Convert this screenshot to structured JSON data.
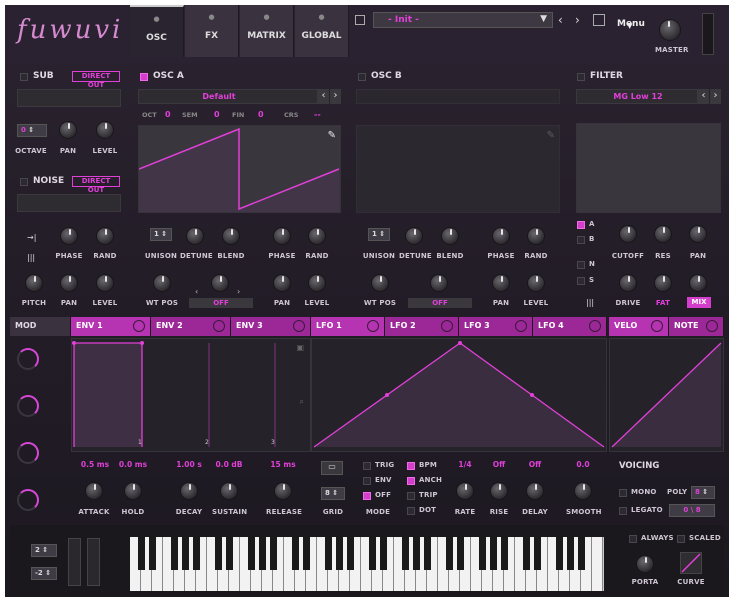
{
  "header": {
    "logo": "fuwuvi",
    "tabs": [
      "OSC",
      "FX",
      "MATRIX",
      "GLOBAL"
    ],
    "active_tab": "OSC",
    "preset_name": "- Init -",
    "menu_label": "Menu",
    "master_label": "MASTER"
  },
  "sub": {
    "title": "SUB",
    "direct_out": "DIRECT OUT",
    "octave_value": "0",
    "labels": [
      "OCTAVE",
      "PAN",
      "LEVEL"
    ]
  },
  "noise": {
    "title": "NOISE",
    "direct_out": "DIRECT OUT"
  },
  "osc_a": {
    "title": "OSC A",
    "wavetable": "Default",
    "oct_label": "OCT",
    "oct_value": "0",
    "sem_label": "SEM",
    "sem_value": "0",
    "fin_label": "FIN",
    "fin_value": "0",
    "crs_label": "CRS",
    "crs_value": "--",
    "unison_value": "1",
    "row1_labels": [
      "PHASE",
      "RAND"
    ],
    "row2_labels": [
      "UNISON",
      "DETUNE",
      "BLEND",
      "PHASE",
      "RAND"
    ],
    "row3_labels": [
      "PITCH",
      "PAN",
      "LEVEL",
      "WT POS",
      "PAN",
      "LEVEL"
    ],
    "wtpos_state": "OFF"
  },
  "osc_b": {
    "title": "OSC B",
    "unison_value": "1",
    "row2_labels": [
      "UNISON",
      "DETUNE",
      "BLEND",
      "PHASE",
      "RAND"
    ],
    "row3_labels": [
      "WT POS",
      "PAN",
      "LEVEL"
    ],
    "wtpos_state": "OFF"
  },
  "filter": {
    "title": "FILTER",
    "type": "MG Low 12",
    "routes": [
      "A",
      "B",
      "N",
      "S"
    ],
    "row1_labels": [
      "CUTOFF",
      "RES",
      "PAN"
    ],
    "row2_labels": [
      "DRIVE",
      "FAT",
      "MIX"
    ]
  },
  "mod_tabs": [
    "MOD",
    "ENV 1",
    "ENV 2",
    "ENV 3",
    "LFO 1",
    "LFO 2",
    "LFO 3",
    "LFO 4",
    "VELO",
    "NOTE"
  ],
  "env": {
    "attack": "0.5 ms",
    "hold": "0.0 ms",
    "decay": "1.00 s",
    "sustain": "0.0 dB",
    "release": "15 ms",
    "labels": [
      "ATTACK",
      "HOLD",
      "DECAY",
      "SUSTAIN",
      "RELEASE"
    ],
    "markers": [
      "1",
      "2",
      "3"
    ]
  },
  "lfo": {
    "grid_label": "GRID",
    "grid_value": "8",
    "mode_label": "MODE",
    "modes": [
      "TRIG",
      "ENV",
      "OFF"
    ],
    "options": [
      "BPM",
      "ANCH",
      "TRIP",
      "DOT"
    ],
    "rate": "1/4",
    "rise": "Off",
    "delay": "Off",
    "smooth": "0.0",
    "labels": [
      "RATE",
      "RISE",
      "DELAY",
      "SMOOTH"
    ]
  },
  "voicing": {
    "title": "VOICING",
    "mono": "MONO",
    "poly": "POLY",
    "poly_value": "8",
    "legato": "LEGATO",
    "legato_value": "0 \\ 8"
  },
  "keyboard": {
    "oct_up": "2",
    "oct_down": "-2",
    "always": "ALWAYS",
    "scaled": "SCALED",
    "porta": "PORTA",
    "curve": "CURVE"
  },
  "colors": {
    "accent": "#d53ecd",
    "panel": "#2e2b31"
  }
}
